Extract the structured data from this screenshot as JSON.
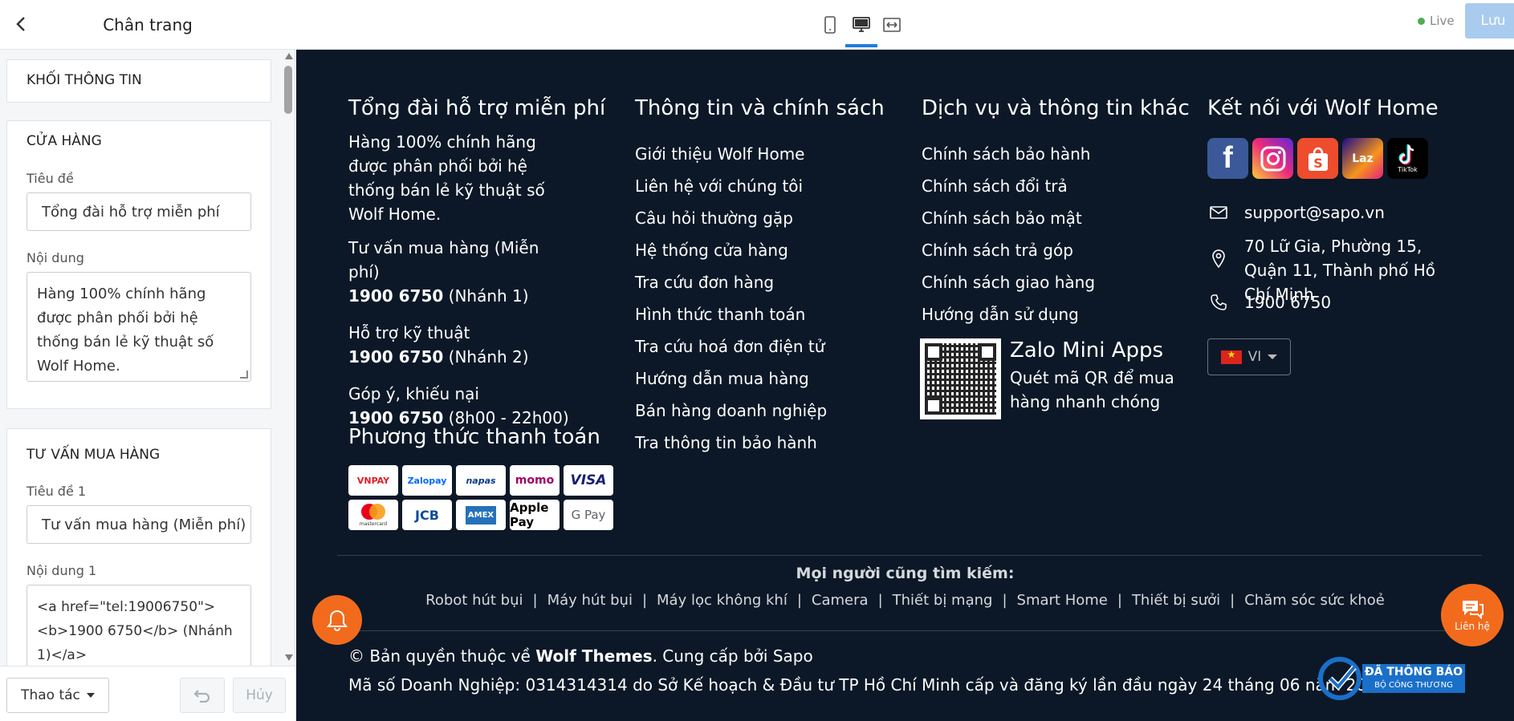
{
  "panel": {
    "title": "Chân trang",
    "scroll_top_card": "KHỐI THÔNG TIN",
    "store_card": {
      "title": "CỬA HÀNG",
      "title_label": "Tiêu đề",
      "title_value": "Tổng đài hỗ trợ miễn phí",
      "content_label": "Nội dung",
      "content_value": "Hàng 100% chính hãng được phân phối bởi hệ thống bán lẻ kỹ thuật số Wolf Home."
    },
    "consult_card": {
      "title": "TƯ VẤN MUA HÀNG",
      "title1_label": "Tiêu đề 1",
      "title1_value": "Tư vấn mua hàng (Miễn phí)",
      "content1_label": "Nội dung 1",
      "content1_value": "<a href=\"tel:19006750\"><b>1900 6750</b> (Nhánh 1)</a>"
    },
    "actions_label": "Thao tác",
    "cancel_label": "Hủy"
  },
  "toolbar": {
    "status": "Live",
    "save_label": "Lưu"
  },
  "footer": {
    "col1": {
      "title": "Tổng đài hỗ trợ miễn phí",
      "intro": "Hàng 100% chính hãng được phân phối bởi hệ thống bán lẻ kỹ thuật số Wolf Home.",
      "blocks": [
        {
          "label": "Tư vấn mua hàng (Miễn phí)",
          "phone": "1900 6750",
          "note": "(Nhánh 1)"
        },
        {
          "label": "Hỗ trợ kỹ thuật",
          "phone": "1900 6750",
          "note": "(Nhánh 2)"
        },
        {
          "label": "Góp ý, khiếu nại",
          "phone": "1900 6750",
          "note": "(8h00 - 22h00)"
        }
      ],
      "payment_title": "Phương thức thanh toán",
      "payments": [
        "VNPAY",
        "Zalopay",
        "napas",
        "momo",
        "VISA",
        "mastercard",
        "JCB",
        "AMEX",
        "Apple Pay",
        "G Pay"
      ]
    },
    "col2": {
      "title": "Thông tin và chính sách",
      "links": [
        "Giới thiệu Wolf Home",
        "Liên hệ với chúng tôi",
        "Câu hỏi thường gặp",
        "Hệ thống cửa hàng",
        "Tra cứu đơn hàng",
        "Hình thức thanh toán",
        "Tra cứu hoá đơn điện tử",
        "Hướng dẫn mua hàng",
        "Bán hàng doanh nghiệp",
        "Tra thông tin bảo hành"
      ]
    },
    "col3": {
      "title": "Dịch vụ và thông tin khác",
      "links": [
        "Chính sách bảo hành",
        "Chính sách đổi trả",
        "Chính sách bảo mật",
        "Chính sách trả góp",
        "Chính sách giao hàng",
        "Hướng dẫn sử dụng"
      ],
      "zalo_title": "Zalo Mini Apps",
      "zalo_text": "Quét mã QR để mua hàng nhanh chóng"
    },
    "col4": {
      "title": "Kết nối với Wolf Home",
      "socials": [
        "facebook",
        "instagram",
        "shopee",
        "lazada",
        "tiktok"
      ],
      "lazada_label": "Laz",
      "tiktok_label": "TikTok",
      "email": "support@sapo.vn",
      "address": "70 Lữ Gia, Phường 15, Quận 11, Thành phố Hồ Chí Minh",
      "phone": "1900 6750",
      "lang": "VI"
    },
    "search_title": "Mọi người cũng tìm kiếm:",
    "search_keywords": [
      "Robot hút bụi",
      "Máy hút bụi",
      "Máy lọc không khí",
      "Camera",
      "Thiết bị mạng",
      "Smart Home",
      "Thiết bị sưởi",
      "Chăm sóc sức khoẻ"
    ],
    "copyright_prefix": "© Bản quyền thuộc về ",
    "copyright_brand": "Wolf Themes",
    "copyright_suffix": ". Cung cấp bởi Sapo",
    "business": "Mã số Doanh Nghiệp: 0314314314 do Sở Kế hoạch & Đầu tư TP Hồ Chí Minh cấp và đăng ký lần đầu ngày 24 tháng 06 năm 2025",
    "contact_fab": "Liên hệ",
    "bct_line1": "ĐÃ THÔNG BÁO",
    "bct_line2": "BỘ CÔNG THƯƠNG"
  },
  "colors": {
    "footer_bg": "#0c1827",
    "accent_orange": "#f26b1d",
    "save_btn": "#a9cbee",
    "active_tab": "#1f7be0"
  }
}
